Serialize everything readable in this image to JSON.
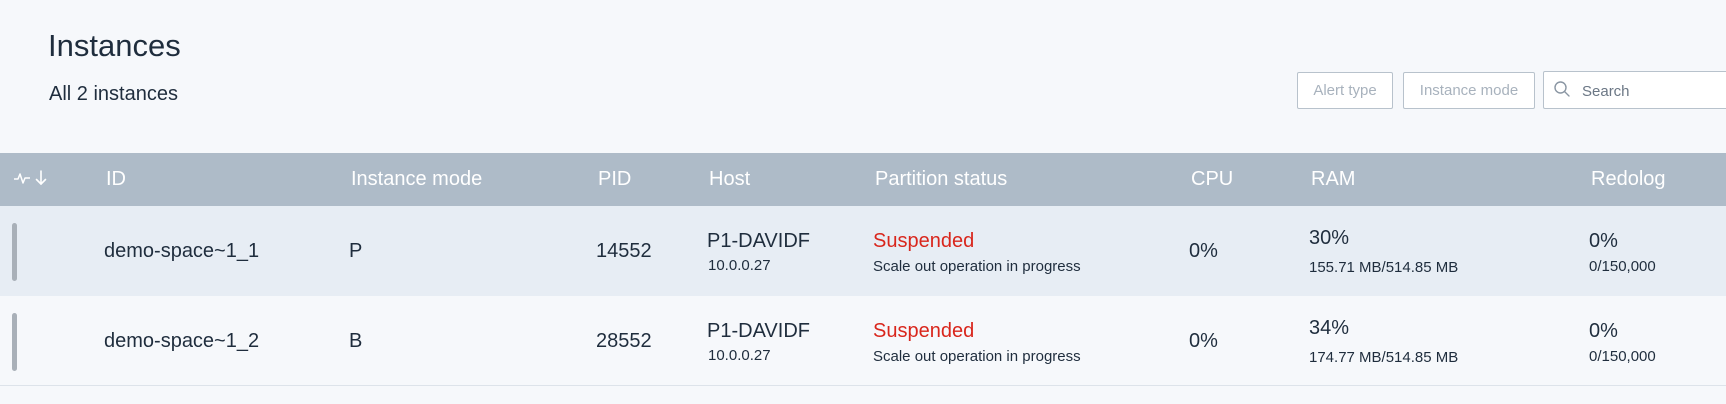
{
  "header": {
    "title": "Instances",
    "subtitle": "All 2 instances"
  },
  "filters": {
    "alert_type_label": "Alert type",
    "instance_mode_label": "Instance mode",
    "search_placeholder": "Search",
    "search_value": ""
  },
  "table": {
    "columns": {
      "id": "ID",
      "instance_mode": "Instance mode",
      "pid": "PID",
      "host": "Host",
      "partition_status": "Partition status",
      "cpu": "CPU",
      "ram": "RAM",
      "redolog": "Redolog"
    },
    "rows": [
      {
        "id": "demo-space~1_1",
        "mode": "P",
        "pid": "14552",
        "host": "P1-DAVIDF",
        "ip": "10.0.0.27",
        "status": "Suspended",
        "status_note": "Scale out operation in progress",
        "cpu": "0%",
        "ram": "30%",
        "ram_detail": "155.71 MB/514.85 MB",
        "redolog": "0%",
        "redolog_detail": "0/150,000"
      },
      {
        "id": "demo-space~1_2",
        "mode": "B",
        "pid": "28552",
        "host": "P1-DAVIDF",
        "ip": "10.0.0.27",
        "status": "Suspended",
        "status_note": "Scale out operation in progress",
        "cpu": "0%",
        "ram": "34%",
        "ram_detail": "174.77 MB/514.85 MB",
        "redolog": "0%",
        "redolog_detail": "0/150,000"
      }
    ]
  },
  "icons": {
    "sort": [
      "activity-icon",
      "arrow-down-icon"
    ],
    "search": "search-icon"
  },
  "colors": {
    "table_header_bg": "#aebbc8",
    "status_suspended": "#d9261c",
    "row_highlight": "#e7edf4"
  }
}
